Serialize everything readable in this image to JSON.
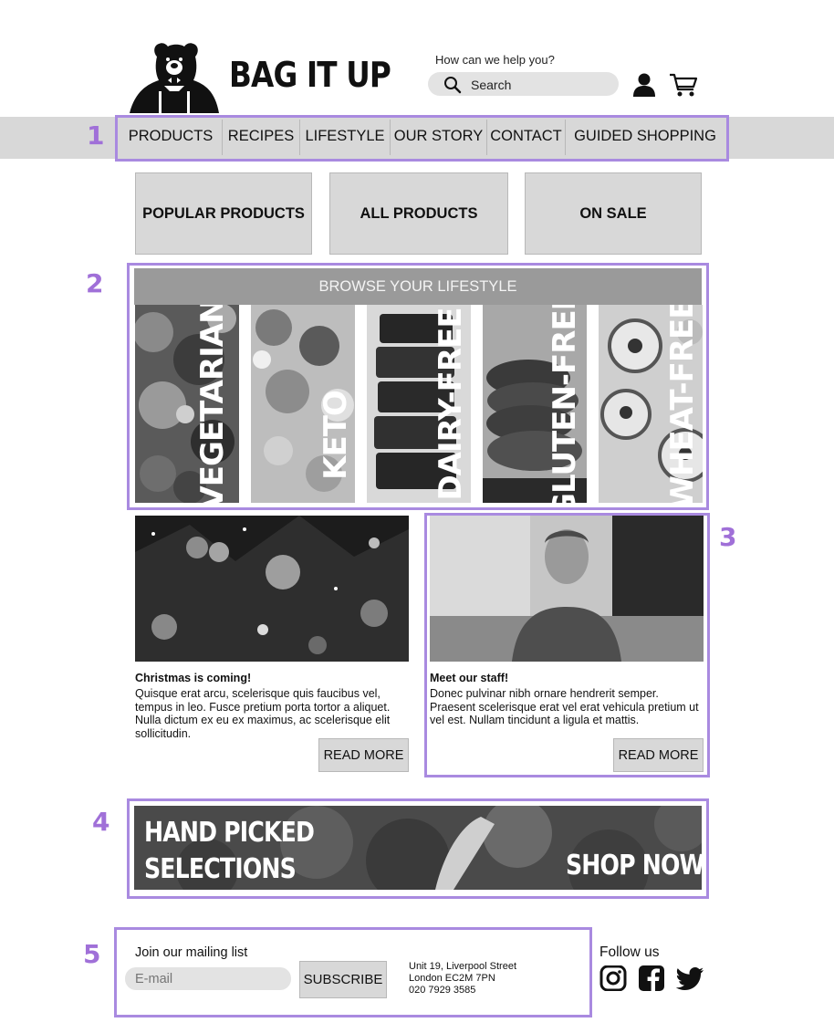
{
  "header": {
    "brand": "BAG IT UP",
    "help_text": "How can we help you?",
    "search_placeholder": "Search",
    "icons": [
      "bear-logo-icon",
      "search-icon",
      "user-icon",
      "cart-icon"
    ]
  },
  "annotations": [
    "1",
    "2",
    "3",
    "4",
    "5"
  ],
  "nav": {
    "items": [
      "PRODUCTS",
      "RECIPES",
      "LIFESTYLE",
      "OUR STORY",
      "CONTACT",
      "GUIDED SHOPPING"
    ]
  },
  "categories": [
    "POPULAR PRODUCTS",
    "ALL PRODUCTS",
    "ON SALE"
  ],
  "lifestyle": {
    "header": "BROWSE YOUR LIFESTYLE",
    "panels": [
      "VEGETARIAN",
      "KETO",
      "DAIRY-FREE",
      "GLUTEN-FREE",
      "WHEAT-FREE"
    ]
  },
  "articles": [
    {
      "title": "Christmas is coming!",
      "body": "Quisque erat arcu, scelerisque quis faucibus vel, tempus in leo. Fusce pretium porta tortor a aliquet. Nulla dictum ex eu ex maximus, ac scelerisque elit sollicitudin.",
      "button": "READ MORE"
    },
    {
      "title": "Meet our staff!",
      "body": "Donec pulvinar nibh ornare hendrerit semper. Praesent scelerisque erat vel erat vehicula pretium ut vel est. Nullam tincidunt a ligula et mattis.",
      "button": "READ MORE"
    }
  ],
  "banner": {
    "title_line1": "HAND PICKED",
    "title_line2": "SELECTIONS",
    "cta": "SHOP NOW"
  },
  "footer": {
    "mailing_label": "Join our mailing list",
    "email_placeholder": "E-mail",
    "subscribe": "SUBSCRIBE",
    "address_line1": "Unit 19, Liverpool Street",
    "address_line2": "London EC2M 7PN",
    "phone": "020 7929 3585",
    "follow": "Follow us",
    "social_icons": [
      "instagram-icon",
      "facebook-icon",
      "twitter-icon"
    ]
  },
  "colors": {
    "annotation": "#a98ae0",
    "nav_band": "#d8d8d8",
    "button_fill": "#d8d8d8",
    "lifestyle_header": "#9a9a9a"
  }
}
